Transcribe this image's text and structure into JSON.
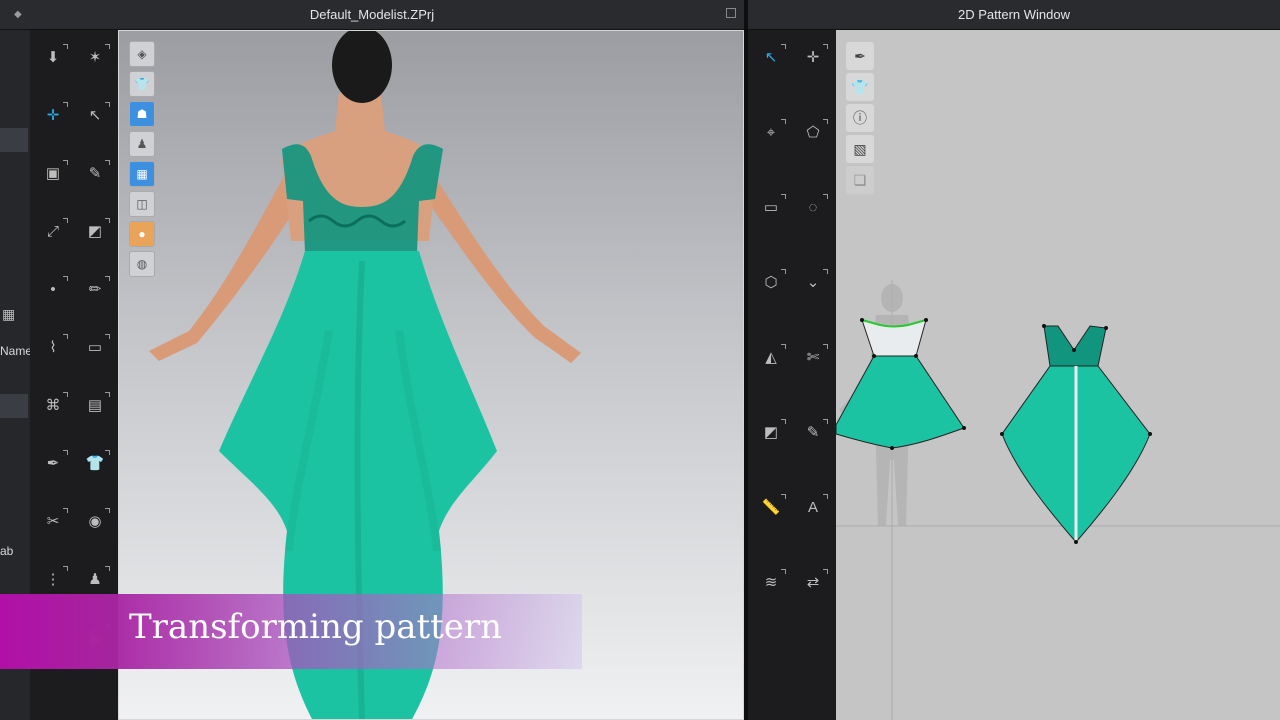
{
  "window_3d": {
    "title": "Default_Modelist.ZPrj"
  },
  "window_2d": {
    "title": "2D Pattern Window"
  },
  "left_panel": {
    "labels": [
      "Name",
      "ab"
    ]
  },
  "caption": {
    "text": "Transforming pattern"
  },
  "colors": {
    "garment": "#1cc3a2",
    "lace": "#12957e",
    "bodice_light": "#e9ecee",
    "banner": "#b10fa8",
    "active_tool": "#29aef0"
  },
  "icons_3d_tools": [
    "move-down-icon",
    "walk-icon",
    "transform-icon",
    "edit-pattern-icon",
    "select-box-icon",
    "sewing-icon",
    "segment-sewing-icon",
    "fold-icon",
    "point-icon",
    "pin-icon",
    "trace-icon",
    "tape-icon",
    "arrange-icon",
    "layer-icon",
    "pen-icon",
    "shirt-icon",
    "cut-icon",
    "button-icon",
    "zip-icon",
    "avatar-icon",
    "measure-icon",
    "lock-icon"
  ],
  "icons_2d_tools": [
    "edit-pattern-icon",
    "transform-icon",
    "edit-point-icon",
    "polygon-icon",
    "rectangle-icon",
    "circle-icon",
    "internal-polygon-icon",
    "notch-icon",
    "dart-icon",
    "trim-icon",
    "fold-icon",
    "sewing-icon",
    "ruler-icon",
    "text-icon",
    "grading-icon",
    "symmetry-icon"
  ],
  "viewport_tools": [
    "garment-icon",
    "shirt-icon",
    "body-icon",
    "avatar-icon",
    "texture-icon",
    "mesh-icon",
    "skin-icon",
    "globe-icon"
  ],
  "pattern_tools": [
    "pen-icon",
    "shirt-icon",
    "info-icon",
    "fabric-icon",
    "layers-icon"
  ]
}
